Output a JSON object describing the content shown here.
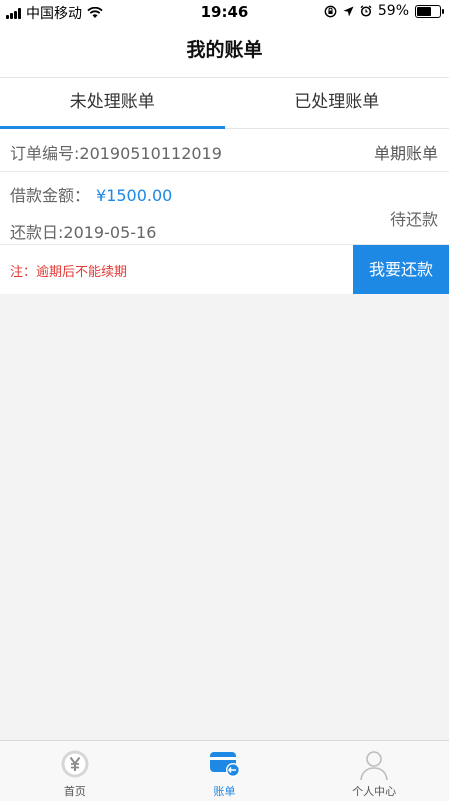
{
  "status_bar": {
    "carrier": "中国移动",
    "time": "19:46",
    "battery_percent": "59%",
    "battery_level": 0.59
  },
  "navbar": {
    "title": "我的账单"
  },
  "tabs": [
    {
      "label": "未处理账单",
      "active": true
    },
    {
      "label": "已处理账单",
      "active": false
    }
  ],
  "bill": {
    "order_number": "订单编号:20190510112019",
    "bill_type": "单期账单",
    "amount_label": "借款金额：",
    "amount_value": "¥1500.00",
    "due_date": "还款日:2019-05-16",
    "status": "待还款",
    "note": "注：逾期后不能续期",
    "repay_button": "我要还款"
  },
  "tabbar": [
    {
      "label": "首页",
      "icon": "yen-icon",
      "active": false
    },
    {
      "label": "账单",
      "icon": "bill-card-icon",
      "active": true
    },
    {
      "label": "个人中心",
      "icon": "user-icon",
      "active": false
    }
  ],
  "colors": {
    "accent": "#1e88e5",
    "warning": "#e53935",
    "background": "#f3f3f3"
  }
}
